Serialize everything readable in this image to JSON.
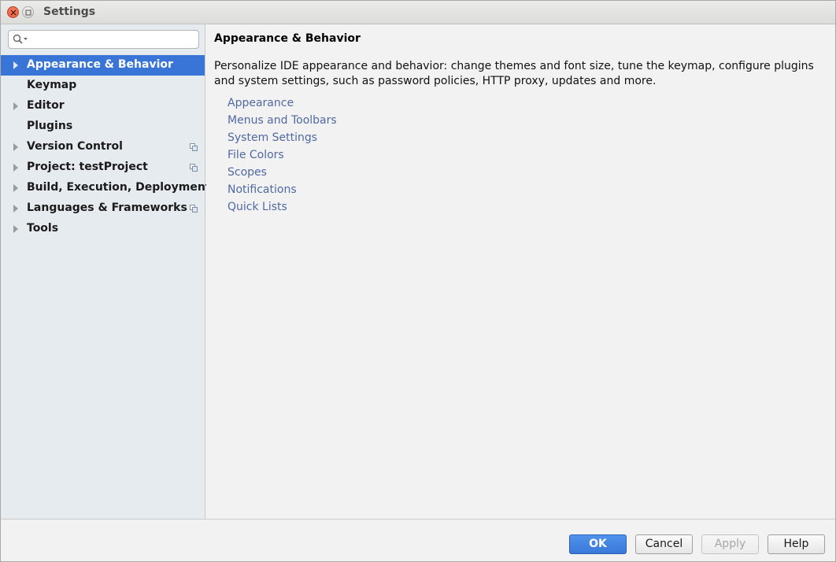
{
  "window": {
    "title": "Settings"
  },
  "search": {
    "placeholder": "",
    "value": ""
  },
  "sidebar": {
    "items": [
      {
        "label": "Appearance & Behavior",
        "expandable": true,
        "selected": true,
        "project_icon": false
      },
      {
        "label": "Keymap",
        "expandable": false,
        "selected": false,
        "project_icon": false
      },
      {
        "label": "Editor",
        "expandable": true,
        "selected": false,
        "project_icon": false
      },
      {
        "label": "Plugins",
        "expandable": false,
        "selected": false,
        "project_icon": false
      },
      {
        "label": "Version Control",
        "expandable": true,
        "selected": false,
        "project_icon": true
      },
      {
        "label": "Project: testProject",
        "expandable": true,
        "selected": false,
        "project_icon": true
      },
      {
        "label": "Build, Execution, Deployment",
        "expandable": true,
        "selected": false,
        "project_icon": false
      },
      {
        "label": "Languages & Frameworks",
        "expandable": true,
        "selected": false,
        "project_icon": true
      },
      {
        "label": "Tools",
        "expandable": true,
        "selected": false,
        "project_icon": false
      }
    ]
  },
  "main": {
    "title": "Appearance & Behavior",
    "description": "Personalize IDE appearance and behavior: change themes and font size, tune the keymap, configure plugins and system settings, such as password policies, HTTP proxy, updates and more.",
    "links": [
      "Appearance",
      "Menus and Toolbars",
      "System Settings",
      "File Colors",
      "Scopes",
      "Notifications",
      "Quick Lists"
    ]
  },
  "buttons": {
    "ok": "OK",
    "cancel": "Cancel",
    "apply": "Apply",
    "help": "Help"
  },
  "colors": {
    "selection": "#3875d7",
    "link": "#5069a2",
    "sidebar_bg": "#e6ebf0"
  },
  "icons": {
    "close": "close-icon",
    "maximize": "maximize-icon",
    "search": "search-icon",
    "expand": "expand-arrow-icon",
    "project_scope": "project-scope-icon"
  }
}
